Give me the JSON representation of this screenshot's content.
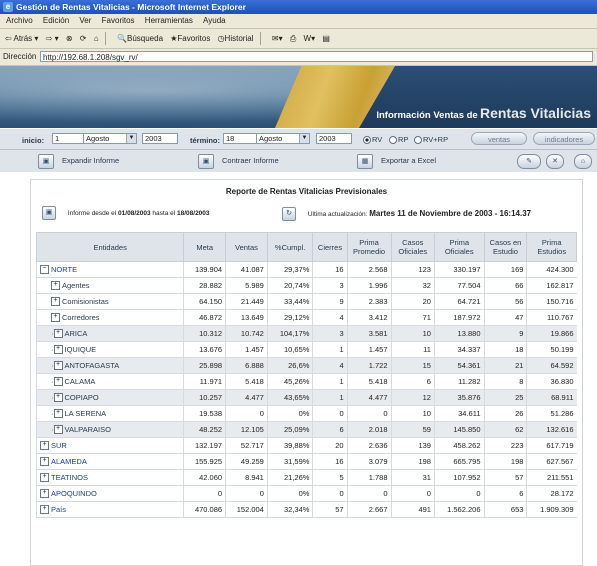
{
  "window": {
    "title": "Gestión de Rentas Vitalicias - Microsoft Internet Explorer"
  },
  "menu": [
    "Archivo",
    "Edición",
    "Ver",
    "Favoritos",
    "Herramientas",
    "Ayuda"
  ],
  "toolbar": {
    "back": "Atrás",
    "search": "Búsqueda",
    "favorites": "Favoritos",
    "history": "Historial"
  },
  "address": {
    "label": "Dirección",
    "url": "http://192.68.1.208/sgv_rv/"
  },
  "banner": {
    "info": "Información Ventas de",
    "big": "Rentas Vitalicias"
  },
  "controls": {
    "inicio_label": "inicio:",
    "inicio_day": "1",
    "inicio_month": "Agosto",
    "inicio_year": "2003",
    "termino_label": "término:",
    "termino_day": "18",
    "termino_month": "Agosto",
    "termino_year": "2003",
    "radio_rv": "RV",
    "radio_rp": "RP",
    "radio_rvrp": "RV+RP",
    "ventas_btn": "ventas",
    "indicadores_btn": "indicadores"
  },
  "actions": {
    "expand": "Expandir Informe",
    "contract": "Contraer Informe",
    "export": "Exportar a Excel"
  },
  "report": {
    "title": "Reporte de Rentas Vitalicias Previsionales",
    "range_prefix": "Informe desde el",
    "range_from": "01/08/2003",
    "range_mid": "hasta el",
    "range_to": "18/08/2003",
    "update_label": "Ultima actualización:",
    "update_value": "Martes 11 de Noviembre de 2003 - 16:14.37",
    "headers": [
      "Entidades",
      "Meta",
      "Ventas",
      "%Cumpl.",
      "Cierres",
      "Prima Promedio",
      "Casos Oficiales",
      "Prima Oficiales",
      "Casos en Estudio",
      "Prima Estudios"
    ],
    "rows": [
      {
        "name": "NORTE",
        "sign": "−",
        "level": 0,
        "shade": false,
        "vals": [
          "139.904",
          "41.087",
          "29,37%",
          "16",
          "2.568",
          "123",
          "330.197",
          "169",
          "424.300"
        ]
      },
      {
        "name": "Agentes",
        "sign": "+",
        "level": 1,
        "shade": false,
        "vals": [
          "28.882",
          "5.989",
          "20,74%",
          "3",
          "1.996",
          "32",
          "77.504",
          "66",
          "162.817"
        ]
      },
      {
        "name": "Comisionistas",
        "sign": "+",
        "level": 1,
        "shade": false,
        "vals": [
          "64.150",
          "21.449",
          "33,44%",
          "9",
          "2.383",
          "20",
          "64.721",
          "56",
          "150.716"
        ]
      },
      {
        "name": "Corredores",
        "sign": "+",
        "level": 1,
        "shade": false,
        "vals": [
          "46.872",
          "13.649",
          "29,12%",
          "4",
          "3.412",
          "71",
          "187.972",
          "47",
          "110.767"
        ]
      },
      {
        "name": "ARICA",
        "sign": "+",
        "level": 2,
        "shade": true,
        "vals": [
          "10.312",
          "10.742",
          "104,17%",
          "3",
          "3.581",
          "10",
          "13.880",
          "9",
          "19.866"
        ]
      },
      {
        "name": "IQUIQUE",
        "sign": "+",
        "level": 2,
        "shade": false,
        "vals": [
          "13.676",
          "1.457",
          "10,65%",
          "1",
          "1.457",
          "11",
          "34.337",
          "18",
          "50.199"
        ]
      },
      {
        "name": "ANTOFAGASTA",
        "sign": "+",
        "level": 2,
        "shade": true,
        "vals": [
          "25.898",
          "6.888",
          "26,6%",
          "4",
          "1.722",
          "15",
          "54.361",
          "21",
          "64.592"
        ]
      },
      {
        "name": "CALAMA",
        "sign": "+",
        "level": 2,
        "shade": false,
        "vals": [
          "11.971",
          "5.418",
          "45,26%",
          "1",
          "5.418",
          "6",
          "11.282",
          "8",
          "36.830"
        ]
      },
      {
        "name": "COPIAPO",
        "sign": "+",
        "level": 2,
        "shade": true,
        "vals": [
          "10.257",
          "4.477",
          "43,65%",
          "1",
          "4.477",
          "12",
          "35.876",
          "25",
          "68.911"
        ]
      },
      {
        "name": "LA SERENA",
        "sign": "+",
        "level": 2,
        "shade": false,
        "vals": [
          "19.538",
          "0",
          "0%",
          "0",
          "0",
          "10",
          "34.611",
          "26",
          "51.286"
        ]
      },
      {
        "name": "VALPARAISO",
        "sign": "+",
        "level": 2,
        "shade": true,
        "vals": [
          "48.252",
          "12.105",
          "25,09%",
          "6",
          "2.018",
          "59",
          "145.850",
          "62",
          "132.616"
        ]
      },
      {
        "name": "SUR",
        "sign": "+",
        "level": 0,
        "shade": false,
        "vals": [
          "132.197",
          "52.717",
          "39,88%",
          "20",
          "2.636",
          "139",
          "458.262",
          "223",
          "617.719"
        ]
      },
      {
        "name": "ALAMEDA",
        "sign": "+",
        "level": 0,
        "shade": false,
        "vals": [
          "155.925",
          "49.259",
          "31,59%",
          "16",
          "3.079",
          "198",
          "665.795",
          "198",
          "627.567"
        ]
      },
      {
        "name": "TEATINOS",
        "sign": "+",
        "level": 0,
        "shade": false,
        "vals": [
          "42.060",
          "8.941",
          "21,26%",
          "5",
          "1.788",
          "31",
          "107.952",
          "57",
          "211.551"
        ]
      },
      {
        "name": "APOQUINDO",
        "sign": "+",
        "level": 0,
        "shade": false,
        "vals": [
          "0",
          "0",
          "0%",
          "0",
          "0",
          "0",
          "0",
          "6",
          "28.172"
        ]
      },
      {
        "name": "País",
        "sign": "+",
        "level": 0,
        "shade": false,
        "vals": [
          "470.086",
          "152.004",
          "32,34%",
          "57",
          "2.667",
          "491",
          "1.562.206",
          "653",
          "1.909.309"
        ]
      }
    ]
  }
}
